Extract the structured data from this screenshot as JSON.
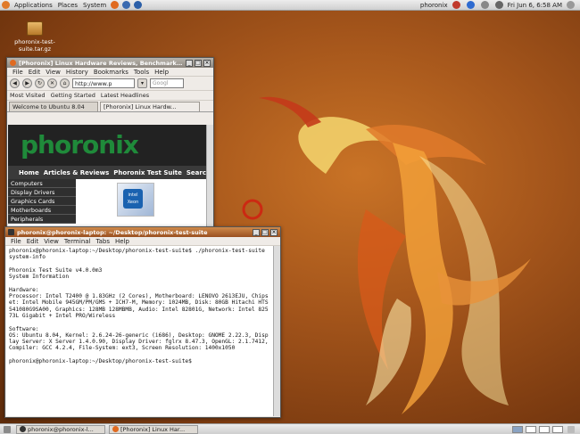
{
  "panel": {
    "menus": [
      "Applications",
      "Places",
      "System"
    ],
    "user": "phoronix",
    "datetime": "Fri Jun  6,  6:58 AM"
  },
  "desktop": {
    "icon_label": "phoronix-test-suite.tar.gz"
  },
  "firefox": {
    "title": "[Phoronix] Linux Hardware Reviews, Benchmarking,",
    "menus": [
      "File",
      "Edit",
      "View",
      "History",
      "Bookmarks",
      "Tools",
      "Help"
    ],
    "url": "http://www.p",
    "search_placeholder": "Googl",
    "bookmarks": [
      "Most Visited",
      "Getting Started",
      "Latest Headlines"
    ],
    "tabs": [
      "Welcome to Ubuntu 8.04",
      "[Phoronix] Linux Hardw..."
    ],
    "page": {
      "logo": "phoronix",
      "nav": [
        "Home",
        "Articles & Reviews",
        "Phoronix Test Suite",
        "Search"
      ],
      "sidebar": [
        "Computers",
        "Display Drivers",
        "Graphics Cards",
        "Motherboards",
        "Peripherals"
      ],
      "ad_text": "intel Xeon"
    }
  },
  "terminal": {
    "title": "phoronix@phoronix-laptop: ~/Desktop/phoronix-test-suite",
    "menus": [
      "File",
      "Edit",
      "View",
      "Terminal",
      "Tabs",
      "Help"
    ],
    "output": "phoronix@phoronix-laptop:~/Desktop/phoronix-test-suite$ ./phoronix-test-suite system-info\n\nPhoronix Test Suite v4.0.0m3\nSystem Information\n\nHardware:\nProcessor: Intel T2400 @ 1.83GHz (2 Cores), Motherboard: LENOVO 2613EJU, Chipset: Intel Mobile 945GM/PM/GMS + ICH7-M, Memory: 1024MB, Disk: 80GB Hitachi HTS541080G9SA00, Graphics: 128MB 128MBMB, Audio: Intel 82801G, Network: Intel 82573L Gigabit + Intel PRO/Wireless\n\nSoftware:\nOS: Ubuntu 8.04, Kernel: 2.6.24-26-generic (i686), Desktop: GNOME 2.22.3, Display Server: X Server 1.4.0.90, Display Driver: fglrx 8.47.3, OpenGL: 2.1.7412, Compiler: GCC 4.2.4, File-System: ext3, Screen Resolution: 1400x1050\n\nphoronix@phoronix-laptop:~/Desktop/phoronix-test-suite$ "
  },
  "taskbar": {
    "items": [
      "phoronix@phoronix-l...",
      "[Phoronix] Linux Har..."
    ]
  },
  "colors": {
    "desktop": "#a4551b",
    "term_title": "#b86a30",
    "logo": "#1f8a3a"
  }
}
